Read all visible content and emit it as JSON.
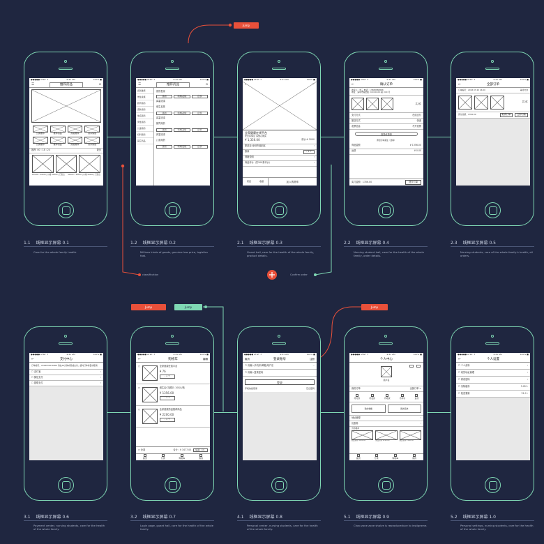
{
  "status": {
    "carrier": "●●●●● AT&T ✈",
    "time": "9:41 AM",
    "battery": "100% ■"
  },
  "screens": [
    {
      "num": "1.1",
      "title": "线框显示屏幕 0.1",
      "desc": "Care for the whole family health.",
      "nav": "推荐药品",
      "h": "推荐",
      "date": "00 : 18 : 24",
      "more": "更多",
      "caption_a": "分类推荐",
      "caption_b": "推荐药品",
      "caption_c": "热卖推荐",
      "caption_d": "营养保健",
      "price_a": "¥1000 • ¥9100 | 价格 ¥9100 | 已售出",
      "price_b": "¥1000 • ¥9100 | 价格 ¥9100 | 已售出"
    },
    {
      "num": "1.2",
      "title": "线框显示屏幕 0.2",
      "desc": "Millions kinds of goods, genuine low price, logistics fast.",
      "nav": "推荐药品",
      "side": [
        "感冒发烧",
        "维生素族",
        "肠胃用药",
        "皮肤用药",
        "性病用药",
        "男性用药",
        "儿童用药",
        "妇科用药",
        "其它药品"
      ],
      "sec_a": "感冒发烧",
      "sec_b": "维生素族",
      "sec_c": "肠胃用药",
      "sec_d": "儿童用药",
      "item_a": "感冒",
      "item_b": "咳嗽发烧",
      "item_c": "止咳",
      "item_d": "鼻塞流涕"
    },
    {
      "num": "2.1",
      "title": "线框显示屏幕 0.3",
      "desc": "Guard hall, care for the health of the whole family, product details.",
      "name": "全家健康在线平台",
      "sub": "安全有保证 请放心购买",
      "price": "¥ 1,356.00",
      "old": "原价:¥ 2000",
      "qty": "数量",
      "qval": "1",
      "spec": "规格说明",
      "deliver": "配送至:深圳市福田区",
      "buy": "加入购物车",
      "qa_a": "药店",
      "qa_b": "收藏",
      "review": "商品评价（共500条评价）"
    },
    {
      "num": "2.2",
      "title": "线框显示屏幕 0.4",
      "desc": "Nursing student hall, care for the health of the whole family, order details.",
      "nav": "确认订单",
      "addr": "收货人：张三 电话：13888888888",
      "addr2": "地址：深圳市福田区 XXXXXXXX 路 XXX 号",
      "count": "共3件",
      "pay": "支付方式",
      "payv": "在线支付",
      "deliver": "配送方式",
      "deliverv": "快递",
      "invoice": "发票信息",
      "invoicev": "不开发票",
      "coupon": "选择优惠券",
      "note": "添加订单备注（选填）",
      "amount": "商品金额",
      "amountv": "¥ 1356.00",
      "freight": "运费",
      "freightv": "¥ 0.00",
      "total": "实付金额：1356.00",
      "submit": "提交订单"
    },
    {
      "num": "2.3",
      "title": "线框显示屏幕 0.5",
      "desc": "Nursing students, care of the whole family's health, all orders.",
      "nav": "全部订单",
      "order": "订单编号：2018 03 20 16:00",
      "state": "等待付款",
      "count": "共3件",
      "total": "实付金额：1356.00",
      "cancel": "取消订单",
      "pay": "立即付款"
    },
    {
      "num": "3.1",
      "title": "线框显示屏幕 0.6",
      "desc": "Payment center, nursing students, care for the health of the whole family.",
      "nav": "支付中心",
      "info": "订单编号：2018032016000 请在30分钟内完成支付，超时订单将自动取消",
      "opts": [
        "支付宝",
        "微信支付",
        "银联支付"
      ]
    },
    {
      "num": "3.2",
      "title": "线框显示屏幕 0.7",
      "desc": "Login page, guard hall, care for the health of the whole family.",
      "nav": "购物车",
      "edit": "编辑",
      "items": [
        {
          "name": "全家健康在线平台",
          "price": "¥ 76"
        },
        {
          "name": "维生素C咀嚼片 100片/瓶",
          "price": "¥ 1356.00"
        },
        {
          "name": "全家健康药品推荐商品",
          "price": "¥ 2200.00"
        }
      ],
      "all": "全选",
      "total": "合计：¥ 3477.00",
      "settle": "结算（3）"
    },
    {
      "num": "4.1",
      "title": "线框显示屏幕 0.8",
      "desc": "Personal center, nursing students, care for the health of the whole family.",
      "nav": "登录账号",
      "back": "取消",
      "reg": "注册",
      "user": "请输入手机号/邮箱/用户名",
      "pwd": "请输入登录密码",
      "login": "登录",
      "quick": "手机快捷登录",
      "forget": "忘记密码"
    },
    {
      "num": "5.1",
      "title": "线框显示屏幕 0.9",
      "desc": "Chao zone zone sholve is reproduceduce to instigrame.",
      "nav": "个人中心",
      "user": "用户名",
      "orders": "我的订单",
      "all": "全部订单 >",
      "stats": [
        "待付款",
        "待发货",
        "待收货",
        "待评价",
        "退款"
      ],
      "my_a": "我的收藏",
      "my_b": "我的足迹",
      "addr": "地址管理",
      "coupon": "优惠券",
      "rec": "为你推荐",
      "rec_items": [
        "商品名称 ¥100.00",
        "商品名称 ¥100.00",
        "商品名称 ¥100.00"
      ]
    },
    {
      "num": "5.2",
      "title": "线框显示屏幕 1.0",
      "desc": "Personal settings, nursing students, care for the health of the whole family.",
      "nav": "个人设置",
      "rows": [
        {
          "l": "个人资料",
          "r": ""
        },
        {
          "l": "收货地址管理",
          "r": ""
        },
        {
          "l": "修改密码",
          "r": ""
        },
        {
          "l": "清除缓存",
          "r": "5.0M"
        },
        {
          "l": "检查更新",
          "r": "V1.0"
        }
      ]
    }
  ],
  "tabbar": [
    "首页",
    "分类",
    "购物车",
    "我的"
  ],
  "annotations": {
    "tag_1": "Jump",
    "tag_2": "Jump",
    "tag_3": "Jump",
    "tag_4": "Jump",
    "tag_5": "Jump",
    "classification": "classification",
    "confirm_order": "Confirm order"
  },
  "colors": {
    "bg": "#1f2640",
    "outline": "#7fd8b4",
    "accent": "#e8503a",
    "secondary": "#7fd8b4"
  }
}
